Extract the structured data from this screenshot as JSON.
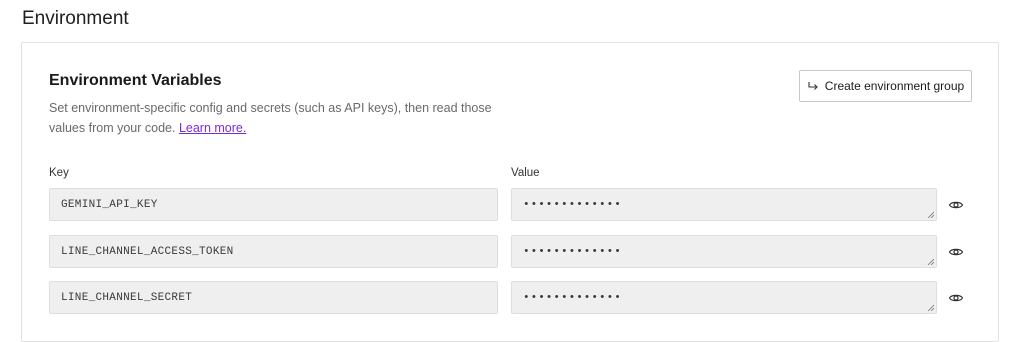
{
  "page": {
    "title": "Environment"
  },
  "section": {
    "title": "Environment Variables",
    "description": "Set environment-specific config and secrets (such as API keys), then read those values from your code.",
    "learn_more": "Learn more.",
    "create_button": "Create environment group"
  },
  "columns": {
    "key": "Key",
    "value": "Value"
  },
  "env_vars": [
    {
      "key": "GEMINI_API_KEY",
      "value": "•••••••••••••"
    },
    {
      "key": "LINE_CHANNEL_ACCESS_TOKEN",
      "value": "•••••••••••••"
    },
    {
      "key": "LINE_CHANNEL_SECRET",
      "value": "•••••••••••••"
    }
  ],
  "icons": {
    "create": "arrow-return-icon",
    "reveal": "eye-icon",
    "resize": "resize-handle-icon"
  },
  "colors": {
    "link": "#7b2bd6",
    "field_bg": "#efefef"
  }
}
